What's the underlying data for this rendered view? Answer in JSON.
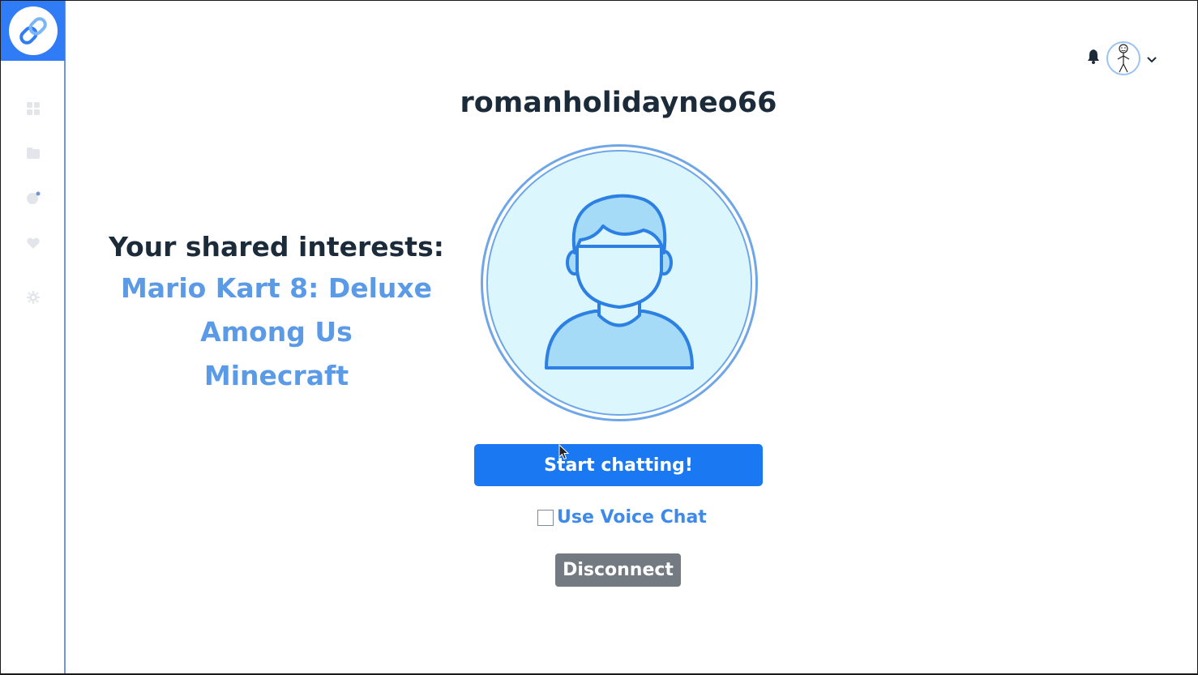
{
  "app": {
    "logo_icon": "link-chain-icon",
    "accent_color": "#1a78f2"
  },
  "sidebar": {
    "items": [
      {
        "icon": "dashboard-grid-icon"
      },
      {
        "icon": "folder-icon"
      },
      {
        "icon": "chat-notification-icon"
      },
      {
        "icon": "heart-icon"
      },
      {
        "icon": "gear-icon"
      }
    ]
  },
  "header": {
    "notification_icon": "bell-icon",
    "user_avatar": "stick-figure-avatar",
    "menu_icon": "chevron-down-icon"
  },
  "match": {
    "username": "romanholidayneo66",
    "interests_heading": "Your shared interests:",
    "interests": [
      "Mario Kart 8: Deluxe",
      "Among Us",
      "Minecraft"
    ],
    "avatar_icon": "default-user-icon"
  },
  "actions": {
    "start_label": "Start chatting!",
    "voice_chat_label": "Use Voice Chat",
    "voice_chat_checked": false,
    "disconnect_label": "Disconnect"
  }
}
